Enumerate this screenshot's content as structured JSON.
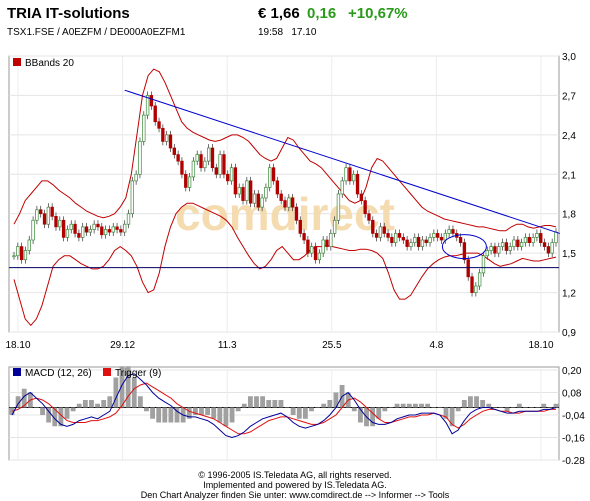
{
  "header": {
    "title": "TRIA IT-solutions",
    "identifiers": "TSX1.FSE  /  A0EZFM  /  DE000A0EZFM1",
    "price": "€ 1,66",
    "change": "0,16",
    "change_pct": "+10,67%",
    "time": "19:58",
    "date": "17.10"
  },
  "colors": {
    "price_up": "#2a9a1a",
    "bbands": "#c00000",
    "trendline": "#0000cc",
    "macd": "#000099",
    "trigger": "#e01010",
    "histogram": "#a0a0a0",
    "candle_up": "#3a8a3a",
    "candle_down": "#b00000",
    "watermark": "#f3d9a8"
  },
  "chart_data": [
    {
      "type": "candlestick",
      "legend": [
        {
          "name": "BBands 20",
          "color": "#c00000"
        }
      ],
      "legend_placement": "top-left",
      "watermark": "comdirect",
      "x_ticks": [
        "18.10",
        "29.12",
        "11.3",
        "25.5",
        "4.8",
        "18.10"
      ],
      "y_ticks": [
        "3,0",
        "2,7",
        "2,4",
        "2,1",
        "1,8",
        "1,5",
        "1,2",
        "0,9"
      ],
      "ylim": [
        0.9,
        3.0
      ],
      "grid": true,
      "price": [
        1.48,
        1.55,
        1.45,
        1.52,
        1.6,
        1.75,
        1.83,
        1.8,
        1.72,
        1.85,
        1.78,
        1.7,
        1.75,
        1.62,
        1.68,
        1.72,
        1.65,
        1.62,
        1.7,
        1.66,
        1.68,
        1.72,
        1.7,
        1.64,
        1.68,
        1.66,
        1.7,
        1.68,
        1.66,
        1.72,
        1.8,
        2.05,
        2.1,
        2.35,
        2.55,
        2.7,
        2.62,
        2.5,
        2.45,
        2.35,
        2.4,
        2.3,
        2.25,
        2.2,
        2.1,
        2.0,
        2.08,
        2.2,
        2.25,
        2.15,
        2.2,
        2.3,
        2.15,
        2.1,
        2.25,
        2.1,
        2.05,
        2.15,
        1.95,
        2.0,
        1.9,
        2.05,
        1.88,
        1.95,
        1.85,
        1.92,
        2.0,
        2.15,
        2.05,
        1.95,
        1.9,
        1.85,
        1.92,
        1.85,
        1.75,
        1.65,
        1.6,
        1.5,
        1.55,
        1.45,
        1.5,
        1.6,
        1.55,
        1.65,
        1.75,
        1.95,
        2.05,
        2.15,
        2.05,
        2.1,
        1.95,
        1.9,
        1.8,
        1.75,
        1.65,
        1.62,
        1.7,
        1.65,
        1.62,
        1.58,
        1.65,
        1.62,
        1.6,
        1.55,
        1.58,
        1.62,
        1.55,
        1.6,
        1.58,
        1.62,
        1.65,
        1.62,
        1.6,
        1.65,
        1.68,
        1.65,
        1.62,
        1.58,
        1.45,
        1.32,
        1.2,
        1.25,
        1.35,
        1.48,
        1.52,
        1.55,
        1.5,
        1.55,
        1.58,
        1.52,
        1.55,
        1.6,
        1.55,
        1.58,
        1.62,
        1.58,
        1.62,
        1.65,
        1.58,
        1.55,
        1.5,
        1.58,
        1.66
      ],
      "bb_upper": [
        1.72,
        1.8,
        1.9,
        1.95,
        2.0,
        2.05,
        2.05,
        2.02,
        1.98,
        1.95,
        1.92,
        1.88,
        1.85,
        1.82,
        1.8,
        1.78,
        1.77,
        1.78,
        1.8,
        1.85,
        1.92,
        2.1,
        2.4,
        2.7,
        2.85,
        2.9,
        2.88,
        2.8,
        2.7,
        2.6,
        2.5,
        2.45,
        2.42,
        2.4,
        2.38,
        2.36,
        2.35,
        2.36,
        2.38,
        2.4,
        2.4,
        2.38,
        2.35,
        2.3,
        2.25,
        2.22,
        2.2,
        2.22,
        2.3,
        2.38,
        2.36,
        2.3,
        2.25,
        2.2,
        2.18,
        2.15,
        2.1,
        2.05,
        2.0,
        1.95,
        1.9,
        1.88,
        1.9,
        2.0,
        2.15,
        2.22,
        2.2,
        2.15,
        2.1,
        2.05,
        2.0,
        1.95,
        1.9,
        1.85,
        1.82,
        1.8,
        1.78,
        1.76,
        1.75,
        1.74,
        1.73,
        1.72,
        1.71,
        1.7,
        1.7,
        1.69,
        1.68,
        1.67,
        1.67,
        1.7,
        1.72,
        1.72,
        1.7,
        1.69,
        1.7,
        1.71,
        1.71,
        1.7
      ],
      "bb_lower": [
        1.3,
        1.15,
        1.0,
        0.95,
        1.0,
        1.1,
        1.25,
        1.4,
        1.45,
        1.48,
        1.48,
        1.45,
        1.42,
        1.4,
        1.38,
        1.38,
        1.4,
        1.45,
        1.52,
        1.55,
        1.52,
        1.48,
        1.4,
        1.28,
        1.2,
        1.22,
        1.35,
        1.55,
        1.7,
        1.8,
        1.85,
        1.88,
        1.88,
        1.86,
        1.84,
        1.82,
        1.8,
        1.78,
        1.75,
        1.7,
        1.62,
        1.55,
        1.48,
        1.42,
        1.38,
        1.4,
        1.45,
        1.52,
        1.55,
        1.5,
        1.45,
        1.45,
        1.48,
        1.52,
        1.55,
        1.55,
        1.56,
        1.55,
        1.54,
        1.53,
        1.52,
        1.52,
        1.53,
        1.53,
        1.52,
        1.5,
        1.46,
        1.35,
        1.22,
        1.15,
        1.15,
        1.18,
        1.25,
        1.32,
        1.38,
        1.42,
        1.45,
        1.47,
        1.48,
        1.48,
        1.49,
        1.5,
        1.5,
        1.5,
        1.48,
        1.45,
        1.42,
        1.4,
        1.41,
        1.42,
        1.44,
        1.46,
        1.45,
        1.44,
        1.44,
        1.45,
        1.46,
        1.47
      ],
      "annotations": [
        {
          "type": "trendline",
          "from": [
            29,
            2.74
          ],
          "to": [
            143,
            1.65
          ],
          "color": "#0000cc"
        },
        {
          "type": "horizontal",
          "y": 1.39,
          "color": "#000066"
        },
        {
          "type": "ellipse",
          "center": [
            118,
            1.55
          ],
          "color": "#0000cc"
        }
      ]
    },
    {
      "type": "line",
      "legend": [
        {
          "name": "MACD (12, 26)",
          "color": "#000099"
        },
        {
          "name": "Trigger (9)",
          "color": "#e01010"
        }
      ],
      "legend_placement": "top-left",
      "x_ticks": [],
      "y_ticks": [
        "0,20",
        "0,08",
        "-0,04",
        "-0,16",
        "-0,28"
      ],
      "ylim": [
        -0.28,
        0.2
      ],
      "grid": true,
      "series": [
        {
          "name": "MACD (12, 26)",
          "values": [
            -0.04,
            0.02,
            0.06,
            0.08,
            0.05,
            0.02,
            -0.02,
            -0.06,
            -0.09,
            -0.1,
            -0.09,
            -0.07,
            -0.06,
            -0.05,
            -0.06,
            -0.04,
            -0.02,
            0.05,
            0.12,
            0.17,
            0.18,
            0.15,
            0.12,
            0.08,
            0.05,
            0.03,
            0.01,
            -0.02,
            -0.04,
            -0.05,
            -0.05,
            -0.06,
            -0.07,
            -0.09,
            -0.12,
            -0.15,
            -0.16,
            -0.15,
            -0.13,
            -0.1,
            -0.08,
            -0.06,
            -0.05,
            -0.04,
            -0.03,
            -0.05,
            -0.08,
            -0.1,
            -0.11,
            -0.1,
            -0.09,
            -0.07,
            -0.04,
            0.0,
            0.06,
            0.08,
            0.04,
            -0.01,
            -0.05,
            -0.08,
            -0.09,
            -0.09,
            -0.08,
            -0.06,
            -0.05,
            -0.04,
            -0.04,
            -0.03,
            -0.03,
            -0.03,
            -0.04,
            -0.08,
            -0.14,
            -0.12,
            -0.07,
            -0.03,
            -0.01,
            0.0,
            0.0,
            -0.01,
            -0.02,
            -0.03,
            -0.03,
            -0.02,
            -0.02,
            -0.02,
            -0.02,
            -0.01,
            -0.01,
            0.0
          ]
        },
        {
          "name": "Trigger (9)",
          "values": [
            -0.02,
            -0.01,
            0.01,
            0.04,
            0.05,
            0.04,
            0.02,
            -0.01,
            -0.04,
            -0.07,
            -0.08,
            -0.08,
            -0.08,
            -0.07,
            -0.07,
            -0.06,
            -0.05,
            -0.03,
            0.01,
            0.06,
            0.1,
            0.12,
            0.13,
            0.11,
            0.09,
            0.07,
            0.05,
            0.02,
            0.0,
            -0.02,
            -0.03,
            -0.04,
            -0.05,
            -0.06,
            -0.08,
            -0.1,
            -0.12,
            -0.14,
            -0.14,
            -0.13,
            -0.11,
            -0.09,
            -0.07,
            -0.06,
            -0.05,
            -0.05,
            -0.06,
            -0.07,
            -0.08,
            -0.09,
            -0.09,
            -0.08,
            -0.06,
            -0.04,
            0.0,
            0.04,
            0.05,
            0.03,
            0.0,
            -0.03,
            -0.06,
            -0.08,
            -0.08,
            -0.07,
            -0.06,
            -0.05,
            -0.05,
            -0.04,
            -0.04,
            -0.03,
            -0.04,
            -0.05,
            -0.09,
            -0.11,
            -0.09,
            -0.06,
            -0.04,
            -0.02,
            -0.01,
            -0.01,
            -0.02,
            -0.02,
            -0.03,
            -0.03,
            -0.02,
            -0.02,
            -0.02,
            -0.02,
            -0.01,
            -0.01
          ]
        }
      ]
    }
  ],
  "footer": {
    "line1": "© 1996-2005 IS.Teledata AG, all rights reserved.",
    "line2": "Implemented and powered by IS.Teledata AG.",
    "line3": "Den Chart Analyzer finden Sie unter: www.comdirect.de --> Informer --> Tools"
  }
}
